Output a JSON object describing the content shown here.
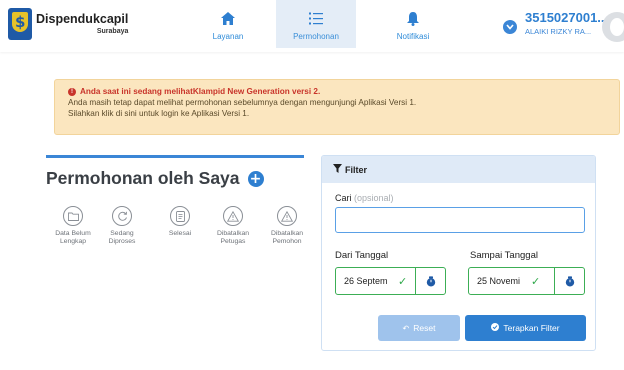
{
  "brand": {
    "title": "Dispendukcapil",
    "subtitle": "Surabaya"
  },
  "nav": {
    "items": [
      {
        "label": "Layanan",
        "icon": "home-icon"
      },
      {
        "label": "Permohonan",
        "icon": "list-icon",
        "active": true
      },
      {
        "label": "Notifikasi",
        "icon": "bell-icon"
      }
    ]
  },
  "user": {
    "nik": "3515027001...",
    "name": "ALAIKI RIZKY RA..."
  },
  "alert": {
    "line1": "Anda saat ini sedang melihatKlampid New Generation versi 2.",
    "line2": "Anda masih tetap dapat melihat permohonan sebelumnya dengan mengunjungi Aplikasi Versi 1.",
    "line3": "Silahkan klik di sini untuk login ke Aplikasi Versi 1."
  },
  "panel": {
    "title": "Permohonan oleh Saya",
    "statuses": [
      {
        "line1": "Data Belum",
        "line2": "Lengkap",
        "icon": "folder-icon"
      },
      {
        "line1": "Sedang",
        "line2": "Diproses",
        "icon": "refresh-icon"
      },
      {
        "line1": "Selesai",
        "line2": "",
        "icon": "document-icon"
      },
      {
        "line1": "Dibatalkan",
        "line2": "Petugas",
        "icon": "warning-icon"
      },
      {
        "line1": "Dibatalkan",
        "line2": "Pemohon",
        "icon": "warning-icon"
      }
    ]
  },
  "filter": {
    "title": "Filter",
    "search_label": "Cari",
    "search_optional": "(opsional)",
    "search_value": "",
    "from_label": "Dari Tanggal",
    "from_value": "26 Septem",
    "to_label": "Sampai Tanggal",
    "to_value": "25 Novemi",
    "reset_label": "Reset",
    "apply_label": "Terapkan Filter"
  },
  "colors": {
    "primary": "#2e7fd0",
    "alert_bg": "#fbe6bf",
    "alert_text": "#c8342a",
    "success": "#3cae55"
  }
}
